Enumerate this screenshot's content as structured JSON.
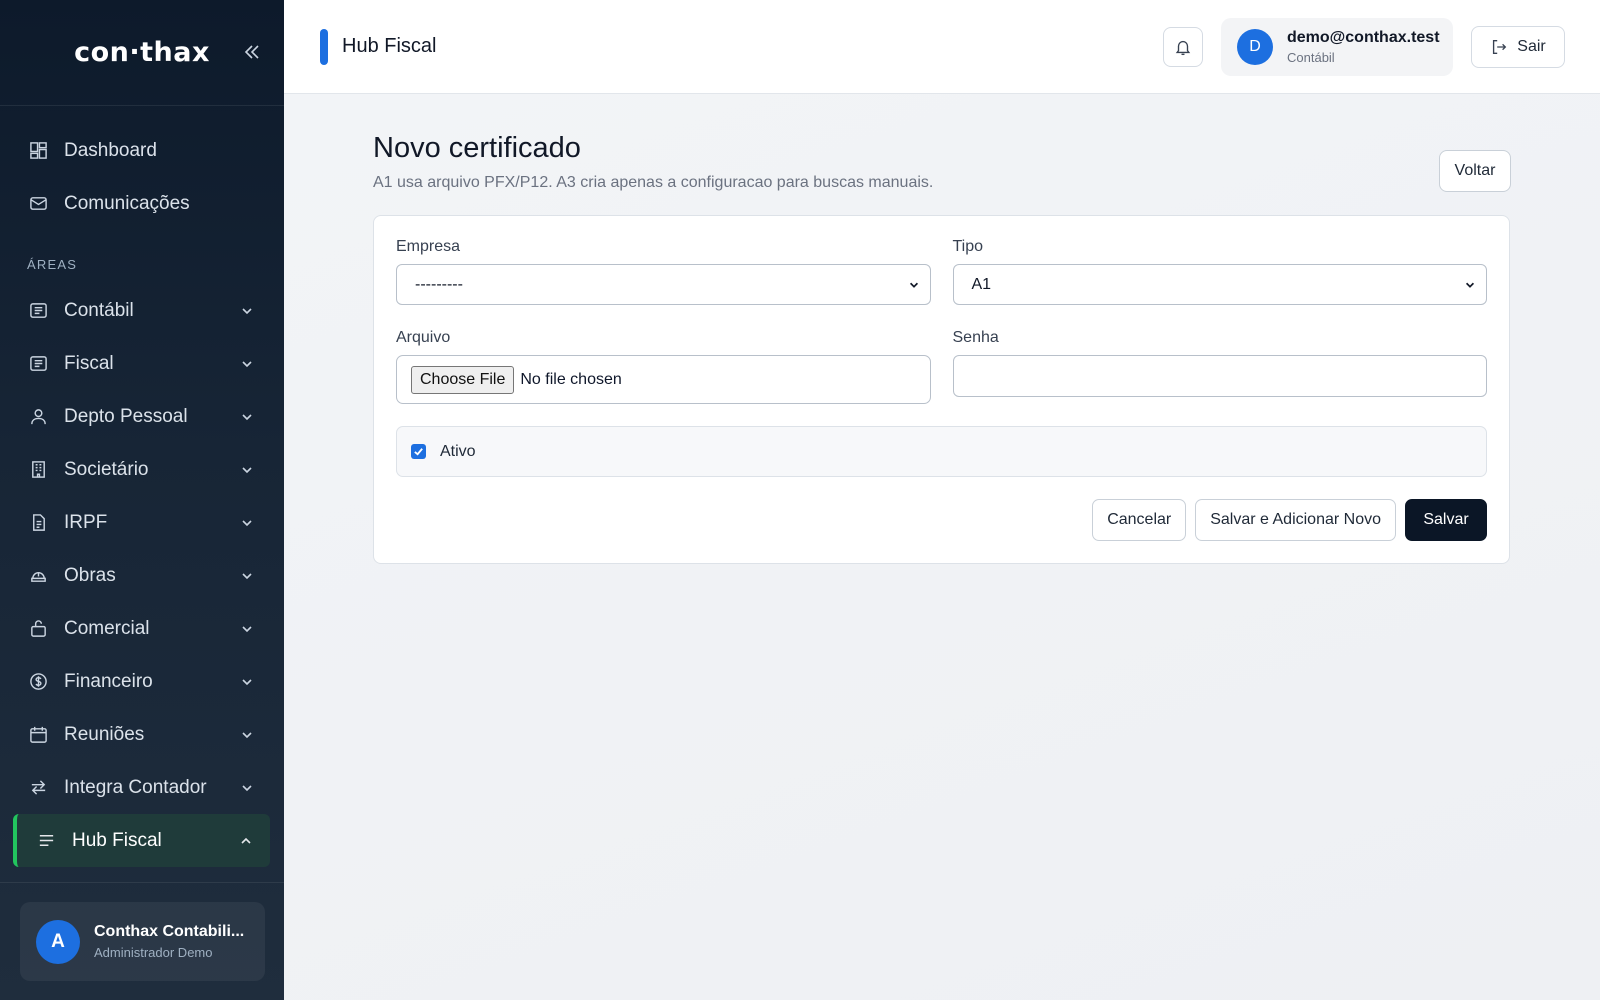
{
  "sidebar": {
    "logo": "con·thax",
    "primary": [
      {
        "label": "Dashboard",
        "icon": "dashboard-icon"
      },
      {
        "label": "Comunicações",
        "icon": "mail-icon"
      }
    ],
    "section_label": "ÁREAS",
    "areas": [
      {
        "label": "Contábil",
        "icon": "ledger-icon"
      },
      {
        "label": "Fiscal",
        "icon": "ledger-icon"
      },
      {
        "label": "Depto Pessoal",
        "icon": "user-icon"
      },
      {
        "label": "Societário",
        "icon": "building-icon"
      },
      {
        "label": "IRPF",
        "icon": "document-icon"
      },
      {
        "label": "Obras",
        "icon": "construction-icon"
      },
      {
        "label": "Comercial",
        "icon": "bag-icon"
      },
      {
        "label": "Financeiro",
        "icon": "dollar-circle-icon"
      },
      {
        "label": "Reuniões",
        "icon": "calendar-icon"
      },
      {
        "label": "Integra Contador",
        "icon": "arrows-swap-icon"
      }
    ],
    "active": {
      "label": "Hub Fiscal",
      "icon": "lines-icon"
    },
    "user": {
      "initial": "A",
      "name": "Conthax Contabili...",
      "role": "Administrador Demo"
    }
  },
  "topbar": {
    "title": "Hub Fiscal",
    "user_initial": "D",
    "user_email": "demo@conthax.test",
    "user_role": "Contábil",
    "logout_label": "Sair"
  },
  "page": {
    "title": "Novo certificado",
    "subtitle": "A1 usa arquivo PFX/P12. A3 cria apenas a configuracao para buscas manuais.",
    "back_label": "Voltar"
  },
  "form": {
    "empresa_label": "Empresa",
    "empresa_value": "---------",
    "tipo_label": "Tipo",
    "tipo_value": "A1",
    "arquivo_label": "Arquivo",
    "file_button": "Choose File",
    "file_status": "No file chosen",
    "senha_label": "Senha",
    "senha_value": "",
    "ativo_label": "Ativo",
    "ativo_checked": true,
    "cancel_label": "Cancelar",
    "save_add_label": "Salvar e Adicionar Novo",
    "save_label": "Salvar"
  },
  "colors": {
    "accent": "#1d6fe0",
    "active_border": "#22c55e",
    "primary_button": "#0b1626"
  }
}
